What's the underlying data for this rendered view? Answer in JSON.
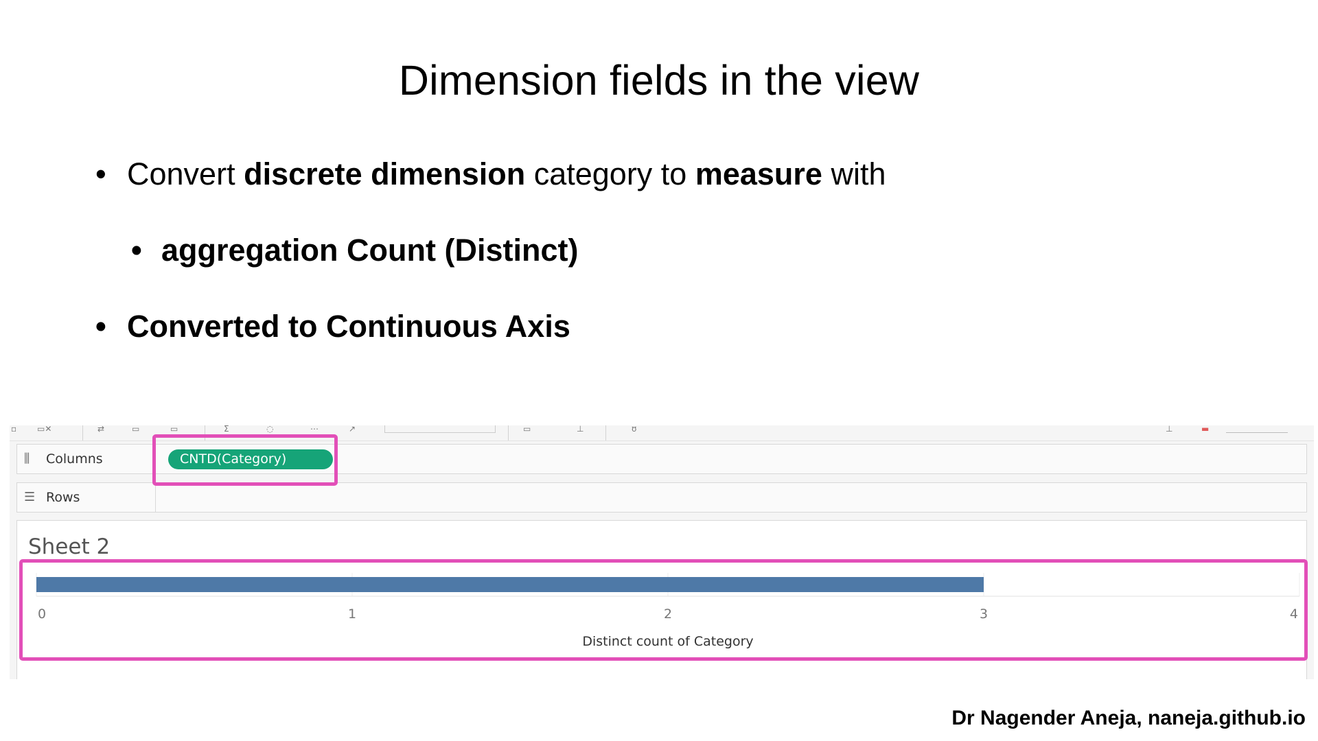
{
  "slide": {
    "title": "Dimension fields in the view",
    "bullet1": {
      "t1": "Convert ",
      "b1": "discrete dimension",
      "t2": " category to ",
      "b2": "measure",
      "t3": " with"
    },
    "bullet2": "aggregation Count (Distinct)",
    "bullet3": "Converted to Continuous Axis",
    "bullet_glyph": "•",
    "footer": "Dr Nagender Aneja, naneja.github.io"
  },
  "tableau": {
    "columns_label": "Columns",
    "rows_label": "Rows",
    "columns_pill": "CNTD(Category)",
    "sheet_title": "Sheet 2",
    "icons": {
      "columns": "columns-shelf-icon",
      "rows": "rows-shelf-icon"
    },
    "colors": {
      "pill": "#16a478",
      "bar": "#4e79a7",
      "highlight": "#e24fb8"
    }
  },
  "chart_data": {
    "type": "bar",
    "orientation": "horizontal",
    "categories": [
      ""
    ],
    "values": [
      3
    ],
    "xlabel": "Distinct count of Category",
    "xlim": [
      0,
      4
    ],
    "xticks": [
      "0",
      "1",
      "2",
      "3",
      "4"
    ],
    "grid": true
  }
}
